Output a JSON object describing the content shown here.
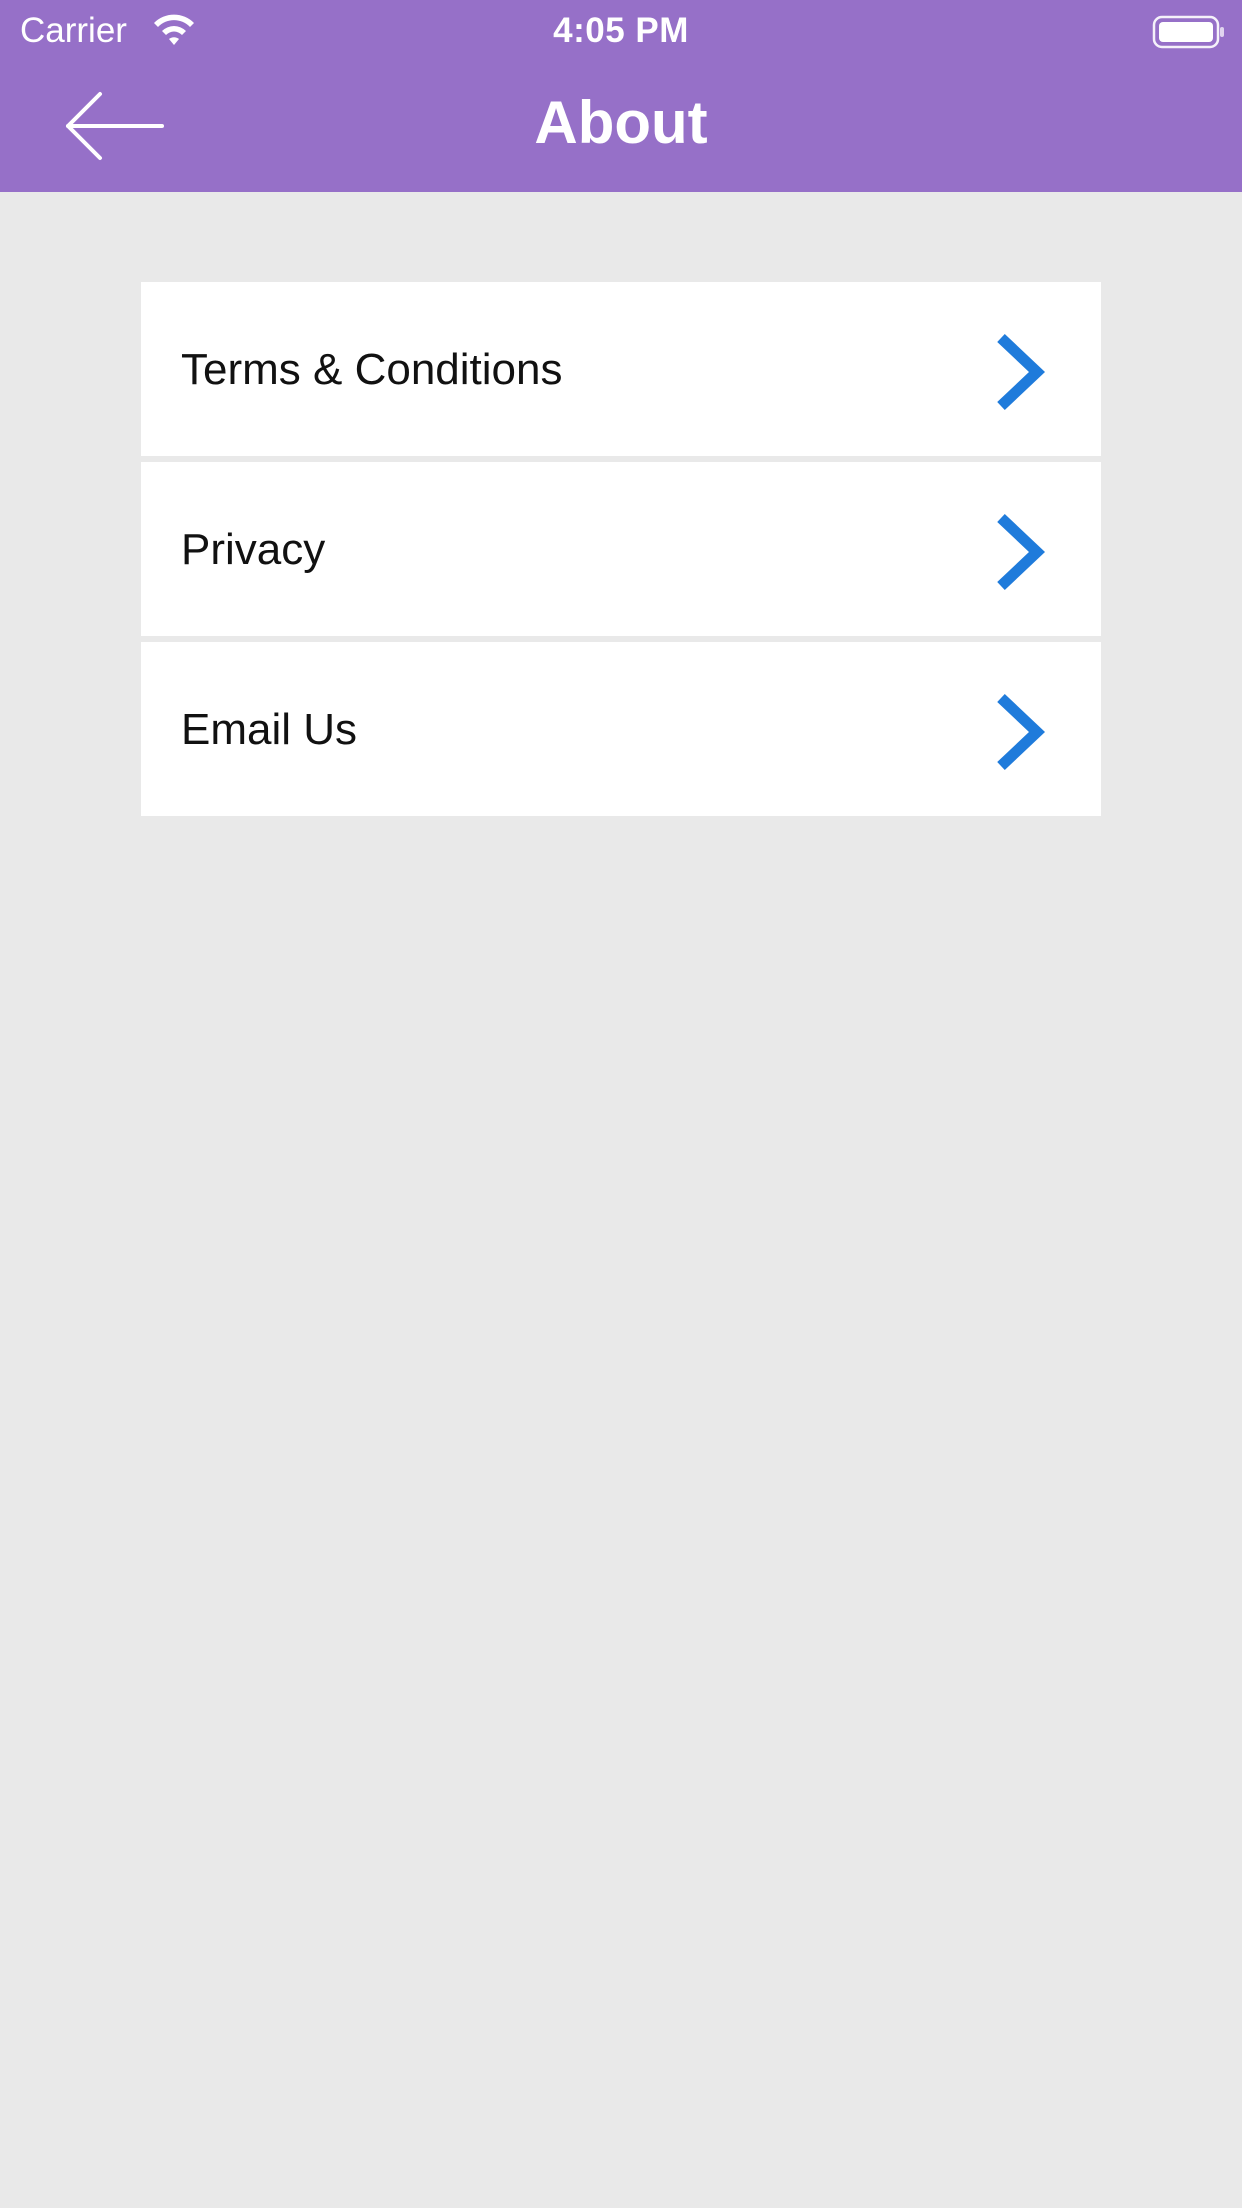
{
  "status_bar": {
    "carrier": "Carrier",
    "time": "4:05 PM",
    "wifi_icon": "wifi-icon",
    "battery_icon": "battery-icon"
  },
  "header": {
    "title": "About",
    "back_icon": "arrow-left-icon",
    "background_color": "#9670c8"
  },
  "menu": {
    "items": [
      {
        "label": "Terms & Conditions",
        "icon": "chevron-right-icon"
      },
      {
        "label": "Privacy",
        "icon": "chevron-right-icon"
      },
      {
        "label": "Email Us",
        "icon": "chevron-right-icon"
      }
    ],
    "chevron_color": "#1f7bdb"
  },
  "page_background": "#e9e9e9"
}
